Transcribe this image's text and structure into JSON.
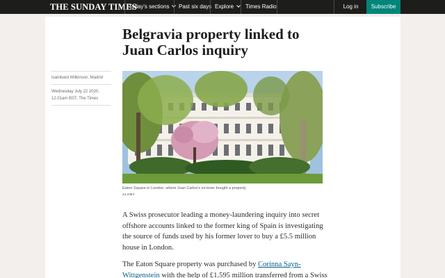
{
  "nav": {
    "logo": "THE SUNDAY TIMES",
    "items": [
      {
        "label": "Today's sections",
        "has_dropdown": true
      },
      {
        "label": "Past six days",
        "has_dropdown": false
      },
      {
        "label": "Explore",
        "has_dropdown": true
      },
      {
        "label": "Times Radio",
        "has_dropdown": false
      }
    ],
    "login": "Log in",
    "subscribe": "Subscribe"
  },
  "colors": {
    "nav_bg": "#1d1d1b",
    "subscribe_bg": "#00857a",
    "link": "#005c8a",
    "page_bg": "#f2efec"
  },
  "article": {
    "headline": "Belgravia property linked to Juan Carlos inquiry",
    "author": "Isambard Wilkinson, Madrid",
    "date_line1": "Wednesday July 22 2020,",
    "date_line2": "12.01am BST, The Times",
    "image_caption": "Eaton Square in London, where Juan Carlos's ex-lover bought a property",
    "image_credit": "ALAMY",
    "paragraph1": "A Swiss prosecutor leading a money-laundering inquiry into secret offshore accounts linked to the former king of Spain is investigating the source of funds used by his former lover to buy a £5.5 million house in London.",
    "paragraph2_before": "The Eaton Square property was purchased by ",
    "paragraph2_link": "Corinna Sayn-Wittgenstein",
    "paragraph2_after": " with the help of £1.595 million transferred from a Swiss"
  }
}
